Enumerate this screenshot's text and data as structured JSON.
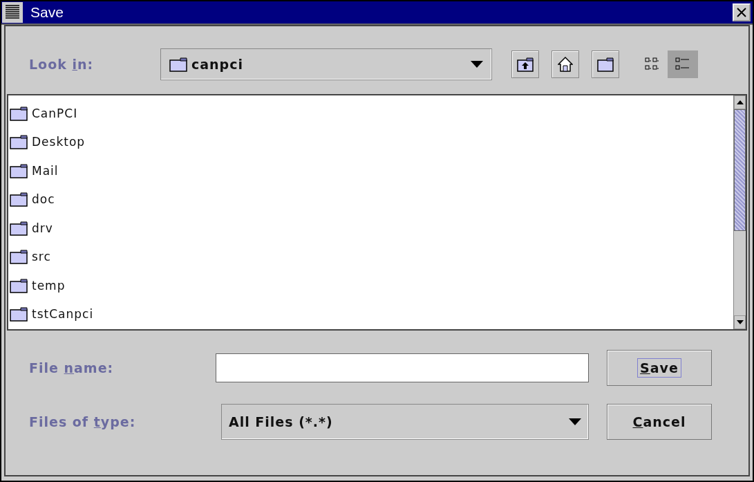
{
  "window": {
    "title": "Save"
  },
  "look_in": {
    "label": {
      "before": "Look ",
      "key": "i",
      "after": "n:"
    },
    "value": "canpci"
  },
  "toolbar": [
    {
      "kind": "up"
    },
    {
      "kind": "home"
    },
    {
      "kind": "new-folder"
    }
  ],
  "view_buttons": [
    {
      "kind": "list",
      "selected": false
    },
    {
      "kind": "details",
      "selected": true
    }
  ],
  "files": [
    {
      "name": "CanPCI"
    },
    {
      "name": "Desktop"
    },
    {
      "name": "Mail"
    },
    {
      "name": "doc"
    },
    {
      "name": "drv"
    },
    {
      "name": "src"
    },
    {
      "name": "temp"
    },
    {
      "name": "tstCanpci"
    }
  ],
  "file_name": {
    "label": {
      "before": "File ",
      "key": "n",
      "after": "ame:"
    }
  },
  "file_type": {
    "label": {
      "before": "Files of ",
      "key": "t",
      "after": "ype:"
    },
    "value": "All Files (*.*)"
  },
  "buttons": [
    {
      "label": {
        "key": "S",
        "after": "ave"
      },
      "focused": true
    },
    {
      "label": {
        "key": "C",
        "after": "ancel"
      },
      "focused": false
    }
  ]
}
